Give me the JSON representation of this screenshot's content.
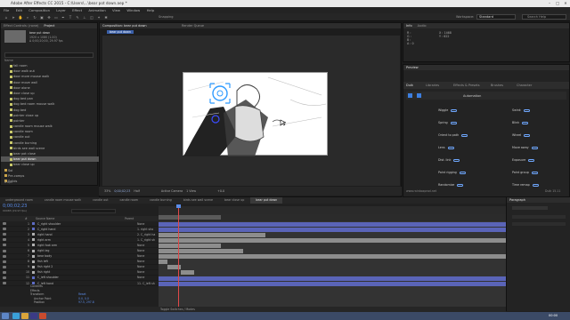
{
  "titlebar": {
    "title": "Adobe After Effects CC 2015 - C:\\Users\\...\\bear pot down.aep *"
  },
  "menu": [
    "File",
    "Edit",
    "Composition",
    "Layer",
    "Effect",
    "Animation",
    "View",
    "Window",
    "Help"
  ],
  "workspace": {
    "label": "Workspace:",
    "value": "Standard",
    "search": "Search Help",
    "snapping": "Snapping"
  },
  "project": {
    "tabs": [
      "Effect Controls: (none)",
      "Project"
    ],
    "comp_name": "bear put down",
    "meta": [
      "1920 x 1080 (1.00)",
      "Δ 0;00;20;00, 29.97 fps"
    ],
    "search_placeholder": "Name",
    "items": [
      {
        "name": "fall room",
        "type": "comp"
      },
      {
        "name": "door walk out",
        "type": "comp"
      },
      {
        "name": "door more mouse walk",
        "type": "comp"
      },
      {
        "name": "door move wall",
        "type": "comp"
      },
      {
        "name": "door alone",
        "type": "comp"
      },
      {
        "name": "door close up",
        "type": "comp"
      },
      {
        "name": "dog bed pan",
        "type": "comp"
      },
      {
        "name": "dog bed room mouse walk",
        "type": "comp"
      },
      {
        "name": "dog bed",
        "type": "comp"
      },
      {
        "name": "pointer close up",
        "type": "comp"
      },
      {
        "name": "pointer",
        "type": "comp"
      },
      {
        "name": "candle room mouse walk",
        "type": "comp"
      },
      {
        "name": "candle room",
        "type": "comp"
      },
      {
        "name": "candle out",
        "type": "comp"
      },
      {
        "name": "candle burning",
        "type": "comp"
      },
      {
        "name": "birds see wall scene",
        "type": "comp"
      },
      {
        "name": "bear pot close",
        "type": "comp"
      },
      {
        "name": "bear put down",
        "type": "comp",
        "selected": true
      },
      {
        "name": "bear close up",
        "type": "comp"
      },
      {
        "name": "Sol",
        "type": "folder"
      },
      {
        "name": "Pre-comps",
        "type": "folder"
      },
      {
        "name": "Solids",
        "type": "folder"
      }
    ],
    "bpc": "8 bpc"
  },
  "composition": {
    "tab": "Composition: bear put down",
    "subtab": "bear put down",
    "right_tab": "Render Queue",
    "zoom": "33%",
    "timecode": "0;00;02;23",
    "resolution": "Half",
    "camera": "Active Camera",
    "views": "1 View",
    "offset": "+0.0"
  },
  "info": {
    "tabs": [
      "Info",
      "Audio"
    ],
    "r": "R :",
    "g": "G :",
    "b": "B :",
    "a": "A : 0",
    "x": "X : 1468",
    "y": "Y : 622"
  },
  "preview": {
    "tab": "Preview"
  },
  "duik": {
    "tabs": [
      "Duik",
      "Libraries",
      "Effects & Presets",
      "Brushes",
      "Character"
    ],
    "section": "Automation",
    "items_left": [
      "Wiggle",
      "Spring",
      "Orient to path",
      "Lens",
      "Dist. link",
      "Paint rigging",
      "Randomize"
    ],
    "items_right": [
      "Swink",
      "Blink",
      "Wheel",
      "Move away",
      "Exposure",
      "Paint group",
      "Time remap"
    ],
    "footer_link": "www.rainboxprod.net",
    "version": "Duik 15.11"
  },
  "timeline": {
    "tabs": [
      "underground room",
      "candle room mouse walk",
      "candle out",
      "candle room",
      "candle burning",
      "birds see wall scene",
      "bear close up",
      "bear put down"
    ],
    "active_tab": "bear put down",
    "timecode": "0;00;02;23",
    "frames": "00083 (29.97 fps)",
    "columns": [
      "#",
      "Source Name",
      "Parent"
    ],
    "layers": [
      {
        "num": "1",
        "name": "C_right shoulder",
        "parent": "None",
        "color": "#5d6bc4"
      },
      {
        "num": "2",
        "name": "C_right hand",
        "parent": "1. right sho",
        "color": "#5d6bc4"
      },
      {
        "num": "3",
        "name": "right hand",
        "parent": "2. C_right ha",
        "color": "#b0b0b0"
      },
      {
        "num": "4",
        "name": "right arm",
        "parent": "1. C_right sh",
        "color": "#b0b0b0"
      },
      {
        "num": "5",
        "name": "right foot arm",
        "parent": "None",
        "color": "#b0b0b0"
      },
      {
        "num": "6",
        "name": "right leg",
        "parent": "None",
        "color": "#b0b0b0"
      },
      {
        "num": "7",
        "name": "bear body",
        "parent": "None",
        "color": "#b0b0b0"
      },
      {
        "num": "8",
        "name": "fish left",
        "parent": "None",
        "color": "#b0b0b0"
      },
      {
        "num": "9",
        "name": "fish right 2",
        "parent": "None",
        "color": "#b0b0b0"
      },
      {
        "num": "10",
        "name": "fish right",
        "parent": "None",
        "color": "#b0b0b0"
      },
      {
        "num": "11",
        "name": "C_left shoulder",
        "parent": "None",
        "color": "#5d6bc4"
      },
      {
        "num": "12",
        "name": "C_left hand",
        "parent": "11. C_left sh",
        "color": "#5d6bc4"
      }
    ],
    "sub_props": [
      "Contents",
      "Effects",
      "Transform",
      "Anchor Point",
      "Position"
    ],
    "sub_values": [
      "Reset",
      "0.0, 0.0",
      "97.5, 297.8"
    ],
    "footer": "Toggle Switches / Modes"
  },
  "paragraph": {
    "tab": "Paragraph"
  },
  "taskbar": {
    "time": "00:00"
  }
}
